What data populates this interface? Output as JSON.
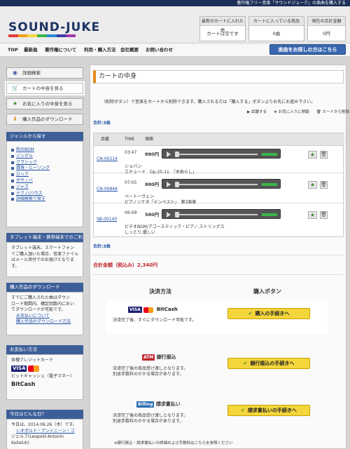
{
  "top_strip": "著作権フリー音楽「サウンドジューク」の楽曲を購入する",
  "header": {
    "logo": "SOUND-JUKE",
    "boxes": [
      {
        "label": "最新のカートに入れた曲",
        "value": "カートは空です"
      },
      {
        "label": "カートに入っている商品",
        "value": "0曲"
      },
      {
        "label": "現在の合計金額",
        "value": "0円"
      }
    ]
  },
  "nav": {
    "items": [
      "TOP",
      "最新曲",
      "著作権について",
      "利用・購入方法",
      "会社概要",
      "お問い合わせ"
    ],
    "search_button": "楽曲をお探しの方はこちら"
  },
  "sidebar": {
    "buttons": [
      "詳細検索",
      "カートの中身を見る",
      "お気に入りの中身を見る",
      "購入作品のダウンロード"
    ],
    "genre_head": "ジャンルから探す",
    "genres": [
      "和のBGM",
      "ジングル",
      "クラシック",
      "環境・ヒーリング",
      "ロック",
      "ボサノバ",
      "ジャズ",
      "テクノ/ハウス",
      "詳細検索で探す"
    ],
    "tablet_head": "タブレット端末・携帯端末でのご利用",
    "tablet_text": [
      "タブレット端末、スマートフォン",
      "でご購入頂いた場合、音楽ファイル",
      "はメール添付でのお届けとなりま",
      "す。"
    ],
    "download_head": "購入作品のダウンロード",
    "download_text": [
      "すでにご購入された曲はダウン",
      "ロード期間内、構定回数内におい",
      "てダウンロードが可能です。"
    ],
    "download_links": [
      "お支払いについて",
      "購入作品のダウンロード方法"
    ],
    "pay_head": "お支払い方法",
    "pay_credit_label": "各種クレジットカード",
    "pay_bitcash_label": "ビットキャッシュ（電子マネー）",
    "visa": "VISA",
    "bitcash": "BitCash",
    "today_head": "今日はどんな日?",
    "today_lines": [
      "今日は、2014.06.26（木）です。",
      "レオポルト・アントニーン・コ",
      "ジェルフ(Leopold Antonín Koželuh)"
    ]
  },
  "main": {
    "title": "カートの中身",
    "info": "（削除ボタン）で音楽をカートから削除できます。購入される方は「購入する」ボタンよりお先にお進み下さい。",
    "legend": [
      "試聴する",
      "お気に入りに移動",
      "カートから削除"
    ],
    "count_top": "合計:3曲",
    "count_bottom": "合計:3曲",
    "columns": [
      "品番",
      "TIME",
      "価格"
    ],
    "rows": [
      {
        "code": "CN-00214",
        "time": "03:47",
        "price": "880円",
        "title1": "ショパン",
        "title2": "エチュード　Op.25-11　「木枯らし」"
      },
      {
        "code": "CN-00846",
        "time": "07:05",
        "price": "880円",
        "title1": "ベートーヴェン",
        "title2": "ピアノソナタ「テンペスト」　第3楽章"
      },
      {
        "code": "SB-00140",
        "time": "06:09",
        "price": "580円",
        "title1": "ビデオBGM/アコースティック・ピアノ,ストリングス",
        "title2": "しっとり,優しい"
      }
    ],
    "total": "合計金額（税込み）2,340円",
    "pay_col1": "決済方法",
    "pay_col2": "購入ボタン",
    "payments": [
      {
        "logo": "VISA  BitCash",
        "desc1": "決済完了後、すぐにダウンロード可能です。",
        "desc2": "",
        "button": "購入の手続きへ",
        "tag": "",
        "tagtitle": ""
      },
      {
        "logo": "ATM",
        "tagtitle": "銀行振込",
        "desc1": "決済完了後の商品受け渡しとなります。",
        "desc2": "別途手数料のかかる場合があります。",
        "button": "銀行振込の手続きへ"
      },
      {
        "logo": "Billing",
        "tagtitle": "請求書払い",
        "desc1": "決済完了後の商品受け渡しとなります。",
        "desc2": "別途手数料のかかる場合があります。",
        "button": "請求書払いの手続きへ"
      }
    ],
    "footnote": "※銀行振込・請求書払いの詳細および手数料はこちらを参照ください"
  },
  "colors": {
    "navy": "#1c2f57",
    "blue": "#3d5f99",
    "yellow": "#f4d53c",
    "orange": "#e08a1d"
  }
}
